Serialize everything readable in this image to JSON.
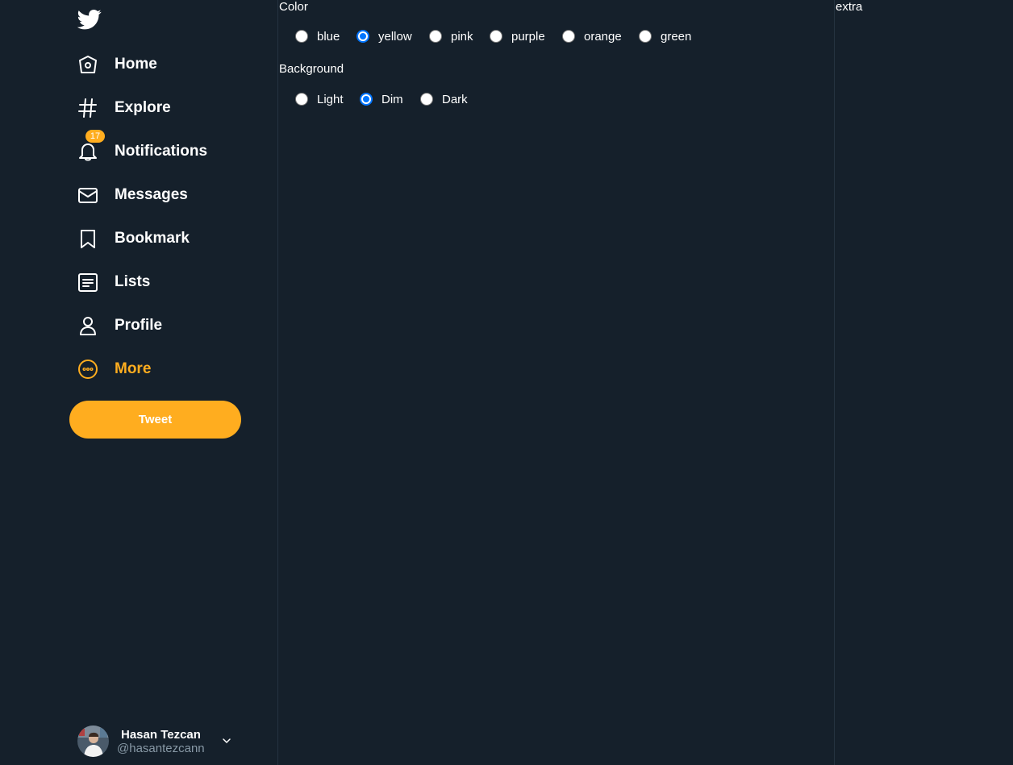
{
  "theme": {
    "accent": "#ffad1f",
    "background": "#15202b",
    "border": "#253341",
    "muted_text": "#8899a6",
    "radio_checked": "#0075ff"
  },
  "sidebar": {
    "logo_icon": "twitter-bird-icon",
    "nav": [
      {
        "label": "Home",
        "icon": "home-icon"
      },
      {
        "label": "Explore",
        "icon": "hashtag-icon"
      },
      {
        "label": "Notifications",
        "icon": "bell-icon",
        "badge": "17"
      },
      {
        "label": "Messages",
        "icon": "envelope-icon"
      },
      {
        "label": "Bookmark",
        "icon": "bookmark-icon"
      },
      {
        "label": "Lists",
        "icon": "list-icon"
      },
      {
        "label": "Profile",
        "icon": "person-icon"
      },
      {
        "label": "More",
        "icon": "more-circle-icon",
        "active": true
      }
    ],
    "tweet_button": "Tweet",
    "account": {
      "name": "Hasan Tezcan",
      "handle": "@hasantezcann",
      "menu_icon": "chevron-down-icon"
    }
  },
  "main": {
    "color": {
      "label": "Color",
      "options": [
        "blue",
        "yellow",
        "pink",
        "purple",
        "orange",
        "green"
      ],
      "selected": "yellow"
    },
    "background": {
      "label": "Background",
      "options": [
        "Light",
        "Dim",
        "Dark"
      ],
      "selected": "Dim"
    }
  },
  "extra": {
    "label": "extra"
  }
}
